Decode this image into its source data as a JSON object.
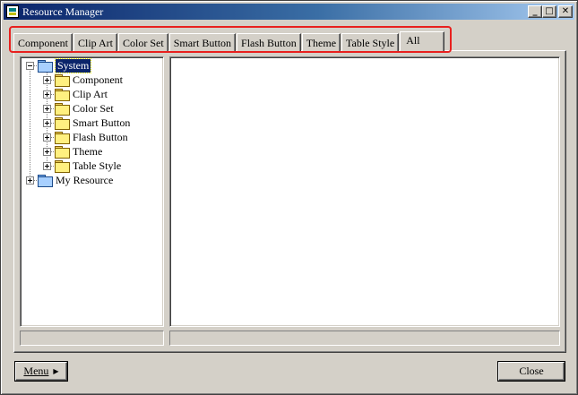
{
  "window": {
    "title": "Resource Manager"
  },
  "caption_buttons": {
    "minimize": "_",
    "maximize": "□",
    "close": "✕"
  },
  "tabs": [
    {
      "label": "Component"
    },
    {
      "label": "Clip Art"
    },
    {
      "label": "Color Set"
    },
    {
      "label": "Smart Button"
    },
    {
      "label": "Flash Button"
    },
    {
      "label": "Theme"
    },
    {
      "label": "Table Style"
    },
    {
      "label": "All",
      "selected": true
    }
  ],
  "tree": {
    "root": {
      "label": "System",
      "expanded": true,
      "selected": true,
      "icon": "folder-open-icon"
    },
    "children": [
      {
        "label": "Component"
      },
      {
        "label": "Clip Art"
      },
      {
        "label": "Color Set"
      },
      {
        "label": "Smart Button"
      },
      {
        "label": "Flash Button"
      },
      {
        "label": "Theme"
      },
      {
        "label": "Table Style"
      }
    ],
    "second_root": {
      "label": "My Resource",
      "expanded": false,
      "icon": "folder-icon"
    }
  },
  "buttons": {
    "menu": "Menu",
    "close": "Close"
  },
  "colors": {
    "titlebar_start": "#0a246a",
    "titlebar_end": "#a6caf0",
    "highlight_outline": "#e8201e",
    "face": "#d4d0c8"
  }
}
